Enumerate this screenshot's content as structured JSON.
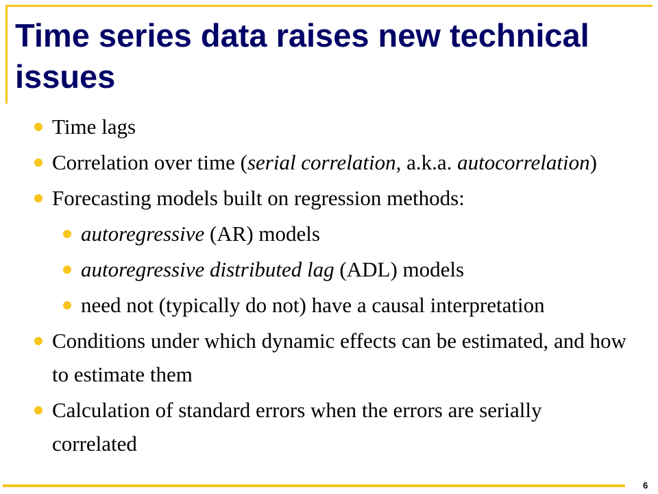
{
  "slide": {
    "title": "Time series data raises new technical issues",
    "page_number": "6",
    "accent_color": "#f7c51c",
    "title_color": "#000066",
    "bullets": [
      {
        "level": 1,
        "parts": [
          {
            "text": "Time lags",
            "italic": false
          }
        ]
      },
      {
        "level": 1,
        "parts": [
          {
            "text": "Correlation over time (",
            "italic": false
          },
          {
            "text": "serial correlation",
            "italic": true
          },
          {
            "text": ", a.k.a. ",
            "italic": false
          },
          {
            "text": "autocorrelation",
            "italic": true
          },
          {
            "text": ")",
            "italic": false
          }
        ]
      },
      {
        "level": 1,
        "parts": [
          {
            "text": "Forecasting models built on regression methods:",
            "italic": false
          }
        ]
      },
      {
        "level": 2,
        "parts": [
          {
            "text": "autoregressive",
            "italic": true
          },
          {
            "text": " (AR) models",
            "italic": false
          }
        ]
      },
      {
        "level": 2,
        "parts": [
          {
            "text": "autoregressive distributed lag",
            "italic": true
          },
          {
            "text": " (ADL) models",
            "italic": false
          }
        ]
      },
      {
        "level": 2,
        "parts": [
          {
            "text": "need not (typically do not) have a causal interpretation",
            "italic": false
          }
        ]
      },
      {
        "level": 1,
        "parts": [
          {
            "text": "Conditions under which dynamic effects can be estimated, and how to estimate them",
            "italic": false
          }
        ]
      },
      {
        "level": 1,
        "parts": [
          {
            "text": "Calculation of standard errors when the errors are serially correlated",
            "italic": false
          }
        ]
      }
    ]
  }
}
